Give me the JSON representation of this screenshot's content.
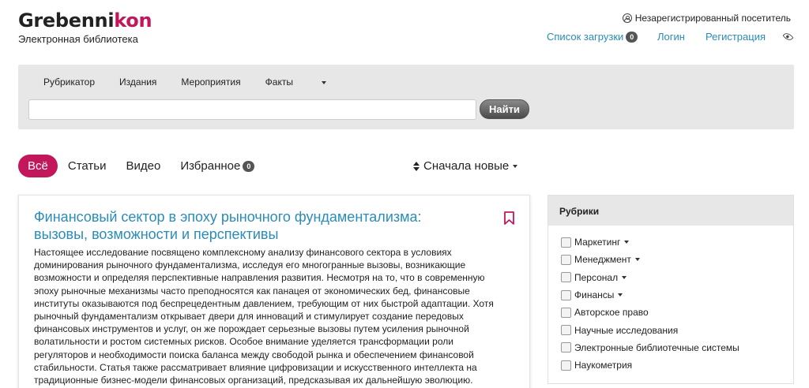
{
  "header": {
    "logo_part1": "Grebenni",
    "logo_part2": "kon",
    "tagline": "Электронная библиотека",
    "visitor": "Незарегистрированный посетитель",
    "downloads_label": "Список загрузки",
    "downloads_count": "0",
    "login": "Логин",
    "register": "Регистрация"
  },
  "search_panel": {
    "menu": [
      "Рубрикатор",
      "Издания",
      "Мероприятия",
      "Факты"
    ],
    "search_value": "",
    "search_button": "Найти"
  },
  "filters": {
    "all": "Всё",
    "articles": "Статьи",
    "video": "Видео",
    "favorites": "Избранное",
    "favorites_count": "0",
    "sort": "Сначала новые"
  },
  "article": {
    "title": "Финансовый сектор в эпоху рыночного фундаментализма: вызовы, возможности и перспективы",
    "text": "Настоящее исследование посвящено комплексному анализу финансового сектора в условиях доминирования рыночного фундаментализма, исследуя его многогранные вызовы, возникающие возможности и определяя перспективные направления развития. Несмотря на то, что в современную эпоху рыночные механизмы часто преподносятся как панацея от экономических бед, финансовые институты оказываются под беспрецедентным давлением, требующим от них быстрой адаптации. Хотя рыночный фундаментализм открывает двери для инноваций и стимулирует создание передовых финансовых инструментов и услуг, он же порождает серьезные вызовы путем усиления рыночной волатильности и ростом системных рисков. Особое внимание уделяется трансформации роли регуляторов и необходимости поиска баланса между свободой рынка и обеспечением финансовой стабильности. Статья также рассматривает влияние цифровизации и искусственного интеллекта на традиционные бизнес-модели финансовых организаций, предсказывая их дальнейшую эволюцию."
  },
  "sidebar": {
    "title": "Рубрики",
    "items": [
      {
        "label": "Маркетинг",
        "has_dropdown": true
      },
      {
        "label": "Менеджмент",
        "has_dropdown": true
      },
      {
        "label": "Персонал",
        "has_dropdown": true
      },
      {
        "label": "Финансы",
        "has_dropdown": true
      },
      {
        "label": "Авторское право",
        "has_dropdown": false
      },
      {
        "label": "Научные исследования",
        "has_dropdown": false
      },
      {
        "label": "Электронные библиотечные системы",
        "has_dropdown": false
      },
      {
        "label": "Наукометрия",
        "has_dropdown": false
      }
    ]
  },
  "colors": {
    "brand": "#c2185b",
    "link": "#2a8cb8",
    "panel": "#e7e7e7"
  }
}
